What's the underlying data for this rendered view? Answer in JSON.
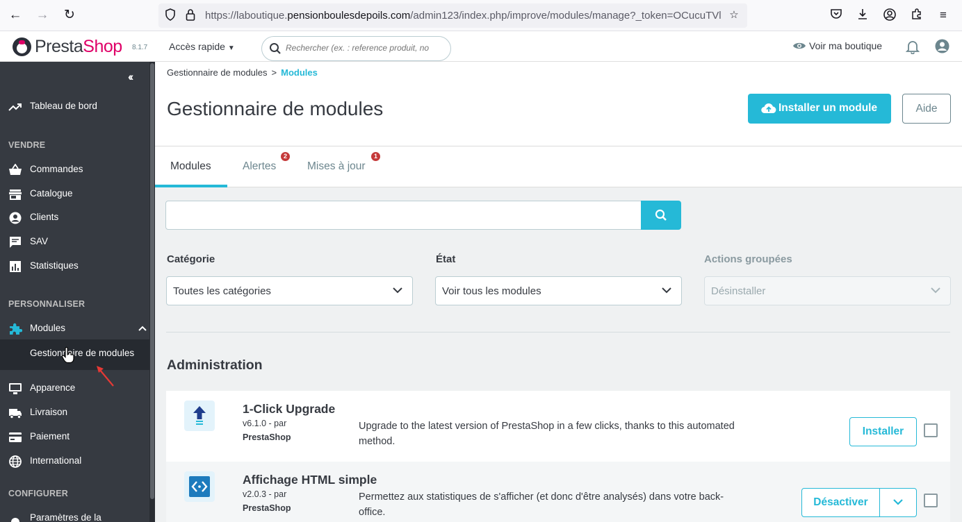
{
  "browser": {
    "url_prefix": "https://laboutique.",
    "url_domain": "pensionboulesdepoils.com",
    "url_path": "/admin123/index.php/improve/modules/manage?_token=OCucuTVl"
  },
  "header": {
    "logo_presta": "Presta",
    "logo_shop": "Shop",
    "version": "8.1.7",
    "quick_access": "Accès rapide",
    "search_placeholder": "Rechercher (ex. : reference produit, no",
    "view_shop": "Voir ma boutique"
  },
  "sidebar": {
    "dashboard": "Tableau de bord",
    "section_sell": "VENDRE",
    "orders": "Commandes",
    "catalog": "Catalogue",
    "customers": "Clients",
    "support": "SAV",
    "stats": "Statistiques",
    "section_customize": "PERSONNALISER",
    "modules": "Modules",
    "module_manager": "Gestionnaire de modules",
    "appearance": "Apparence",
    "shipping": "Livraison",
    "payment": "Paiement",
    "international": "International",
    "section_configure": "CONFIGURER",
    "shop_params": "Paramètres de la"
  },
  "page": {
    "breadcrumb_parent": "Gestionnaire de modules",
    "breadcrumb_sep": ">",
    "breadcrumb_current": "Modules",
    "title": "Gestionnaire de modules",
    "install_button": "Installer un module",
    "help_button": "Aide"
  },
  "tabs": [
    {
      "label": "Modules",
      "badge": ""
    },
    {
      "label": "Alertes",
      "badge": "2"
    },
    {
      "label": "Mises à jour",
      "badge": "1"
    }
  ],
  "filters": {
    "category_label": "Catégorie",
    "category_value": "Toutes les catégories",
    "state_label": "État",
    "state_value": "Voir tous les modules",
    "bulk_label": "Actions groupées",
    "bulk_value": "Désinstaller"
  },
  "section": {
    "title": "Administration"
  },
  "modules": [
    {
      "name": "1-Click Upgrade",
      "version": "v6.1.0 - par",
      "author": "PrestaShop",
      "description": "Upgrade to the latest version of PrestaShop in a few clicks, thanks to this automated method.",
      "action": "Installer"
    },
    {
      "name": "Affichage HTML simple",
      "version": "v2.0.3 - par",
      "author": "PrestaShop",
      "description": "Permettez aux statistiques de s'afficher (et donc d'être analysés) dans votre back-office.",
      "action": "Désactiver"
    }
  ],
  "colors": {
    "accent": "#25b9d7",
    "sidebar": "#363a41",
    "brand_pink": "#df0067",
    "badge": "#c53a3a"
  }
}
